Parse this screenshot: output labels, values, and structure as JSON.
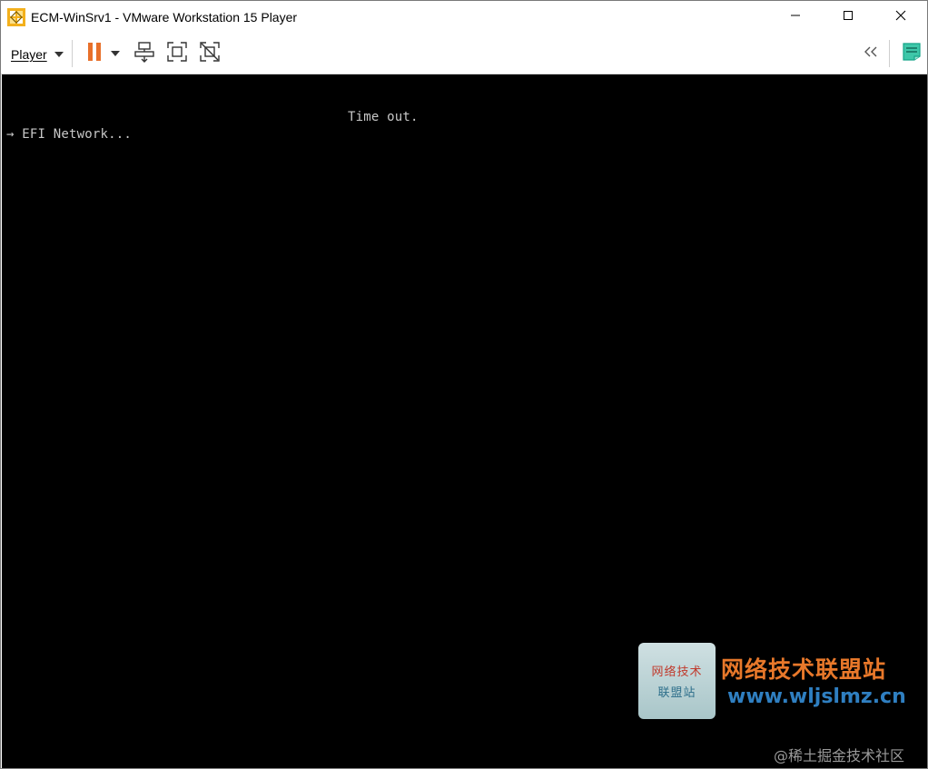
{
  "window": {
    "title": "ECM-WinSrv1 - VMware Workstation 15 Player",
    "app_icon": "vmware-icon",
    "controls": [
      "minimize-icon",
      "maximize-icon",
      "close-icon"
    ]
  },
  "toolbar": {
    "player_menu_label": "Player",
    "icons": [
      "pause-icon",
      "dropdown-caret-icon",
      "send-ctrl-alt-del-icon",
      "full-screen-icon",
      "unity-icon",
      "collapse-left-icon",
      "message-log-icon"
    ],
    "pause_color": "#e8702a",
    "accent_color": "#16a589"
  },
  "console": {
    "background": "#000000",
    "timeout_text": "Time out.",
    "boot_line": "→ EFI Network..."
  },
  "watermark": {
    "logo_line1": "网络技术",
    "logo_line2": "联盟站",
    "title": "网络技术联盟站",
    "url": "www.wljslmz.cn",
    "credit": "@稀土掘金技术社区"
  }
}
